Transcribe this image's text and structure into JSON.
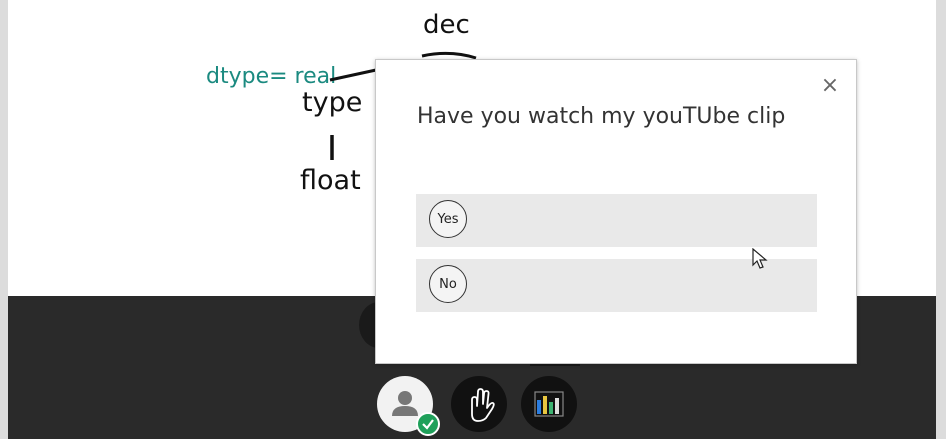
{
  "whiteboard": {
    "annotations": {
      "dec": "dec",
      "dtype": "dtype= real",
      "type": "type",
      "float": "float"
    }
  },
  "poll": {
    "close_symbol": "×",
    "question": "Have you watch my youTUbe clip",
    "options": [
      {
        "label": "Yes"
      },
      {
        "label": "No"
      }
    ]
  },
  "toolbar": {
    "buttons": [
      {
        "icon": "user-icon",
        "status": "check-icon"
      },
      {
        "icon": "raise-hand-icon"
      },
      {
        "icon": "poll-chart-icon"
      }
    ],
    "colors": {
      "status_green": "#1fa05a",
      "annotation_teal": "#1b8a80"
    }
  }
}
